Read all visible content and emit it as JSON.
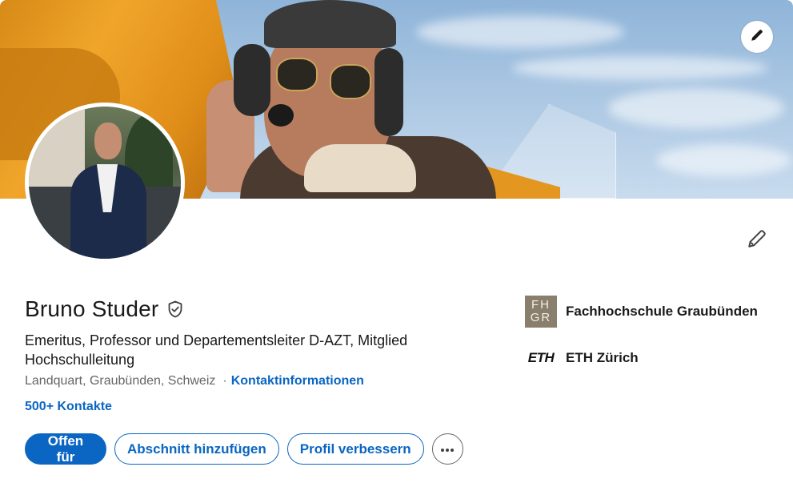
{
  "profile": {
    "name": "Bruno Studer",
    "headline": "Emeritus, Professor und Departementsleiter D-AZT, Mitglied Hochschulleitung",
    "location": "Landquart, Graubünden, Schweiz",
    "separator": "·",
    "contact_info_label": "Kontaktinformationen",
    "connections_label": "500+ Kontakte"
  },
  "actions": {
    "open_to_label": "Offen für",
    "add_section_label": "Abschnitt hinzufügen",
    "improve_profile_label": "Profil verbessern",
    "more_label": "···"
  },
  "organizations": [
    {
      "name": "Fachhochschule Graubünden",
      "logo_text_top": "FH",
      "logo_text_bottom": "GR"
    },
    {
      "name": "ETH Zürich",
      "logo_text": "ETH"
    }
  ],
  "icons": {
    "banner_edit": "pencil-icon",
    "profile_edit": "pencil-icon",
    "verified": "shield-check-icon",
    "more": "ellipsis-icon"
  },
  "colors": {
    "accent": "#0a66c2",
    "text": "#191919",
    "muted": "#666666",
    "fh_logo_bg": "#8a7f6c"
  }
}
